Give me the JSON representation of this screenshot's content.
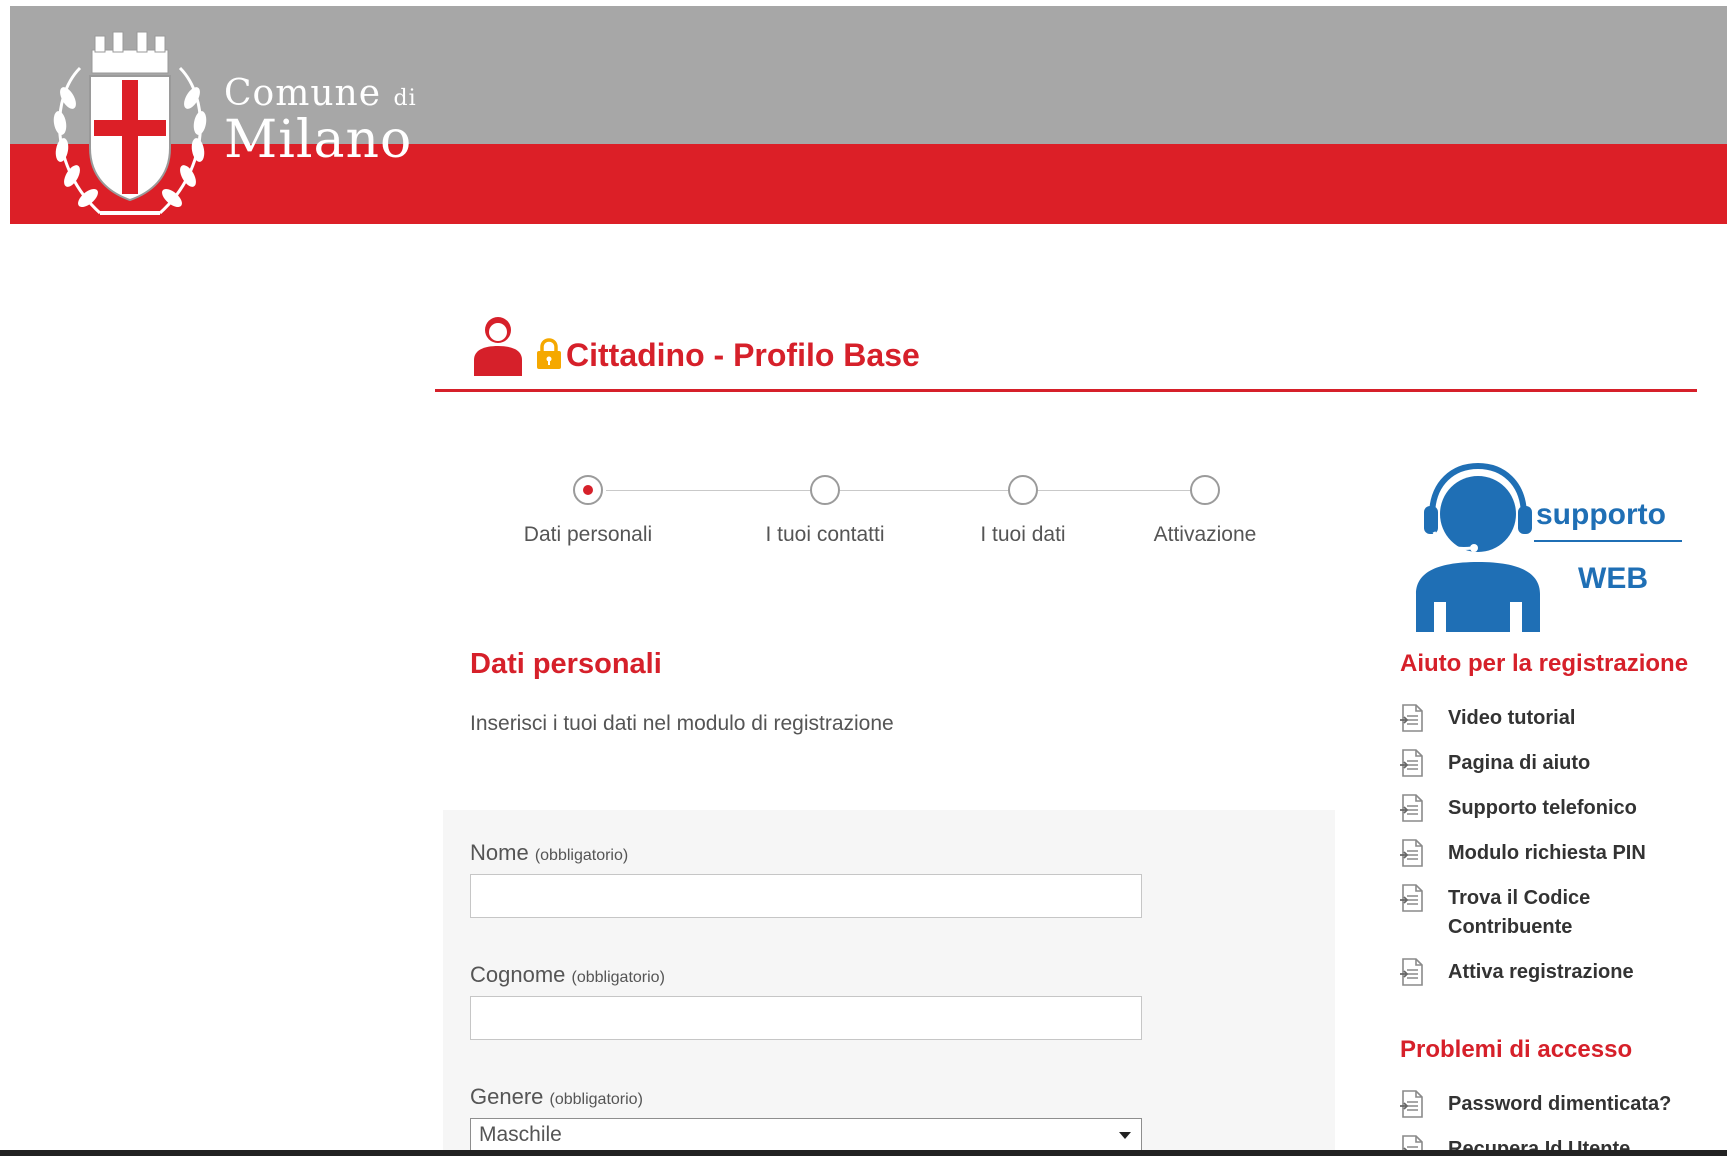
{
  "header": {
    "brand_line1": "Comune",
    "brand_line1_small": "di",
    "brand_line2": "Milano",
    "logo_icon": "milan-coat-of-arms-icon",
    "colors": {
      "grey": "#a7a7a7",
      "red": "#dc1f27"
    }
  },
  "page": {
    "title": "Cittadino - Profilo Base",
    "title_icon": "user-icon",
    "lock_icon": "lock-icon",
    "accent": "#d6202a"
  },
  "stepper": {
    "steps": [
      {
        "label": "Dati personali",
        "active": true
      },
      {
        "label": "I tuoi contatti",
        "active": false
      },
      {
        "label": "I tuoi dati",
        "active": false
      },
      {
        "label": "Attivazione",
        "active": false
      }
    ]
  },
  "section": {
    "title": "Dati personali",
    "description": "Inserisci i tuoi dati nel modulo di registrazione"
  },
  "form": {
    "nome": {
      "label": "Nome",
      "hint": "(obbligatorio)",
      "value": ""
    },
    "cognome": {
      "label": "Cognome",
      "hint": "(obbligatorio)",
      "value": ""
    },
    "genere": {
      "label": "Genere",
      "hint": "(obbligatorio)",
      "selected": "Maschile"
    }
  },
  "sidebar": {
    "support_badge": {
      "line1": "supporto",
      "line2": "WEB",
      "color": "#1f6fb5"
    },
    "help_heading": "Aiuto per la registrazione",
    "help_items": [
      "Video tutorial",
      "Pagina di aiuto",
      "Supporto telefonico",
      "Modulo richiesta PIN",
      "Trova il Codice Contribuente",
      "Attiva registrazione"
    ],
    "access_heading": "Problemi di accesso",
    "access_items": [
      "Password dimenticata?",
      "Recupera Id Utente"
    ]
  }
}
